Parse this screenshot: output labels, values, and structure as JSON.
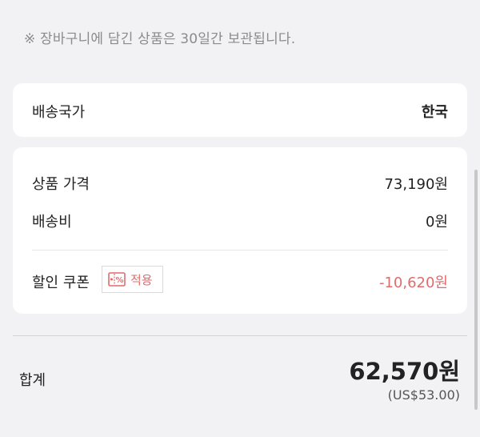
{
  "notice": "※ 장바구니에 담긴 상품은 30일간 보관됩니다.",
  "shipping_country": {
    "label": "배송국가",
    "value": "한국"
  },
  "price_summary": {
    "product_price_label": "상품 가격",
    "product_price_value": "73,190원",
    "shipping_fee_label": "배송비",
    "shipping_fee_value": "0원",
    "coupon_label": "할인 쿠폰",
    "coupon_button_label": "적용",
    "coupon_icon": "coupon-icon",
    "discount_value": "-10,620원"
  },
  "total": {
    "label": "합계",
    "value": "62,570원",
    "usd_value": "(US$53.00)"
  },
  "colors": {
    "background": "#f2f2f4",
    "card": "#ffffff",
    "discount": "#e06c6c",
    "notice_text": "#8b8b8b"
  }
}
